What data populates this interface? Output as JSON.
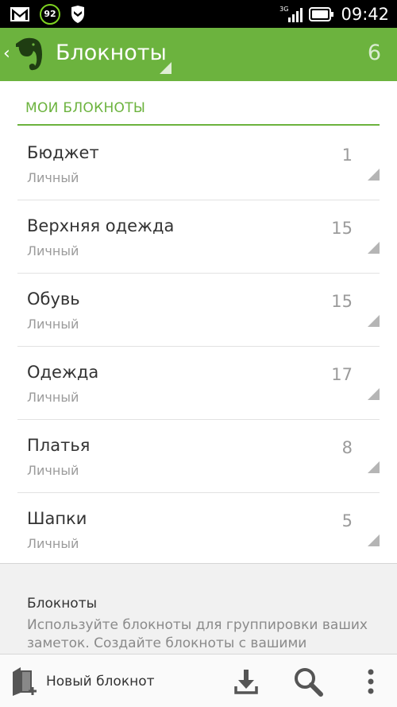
{
  "status_bar": {
    "battery_level": "92",
    "network": "3G",
    "time": "09:42"
  },
  "action_bar": {
    "title": "Блокноты",
    "count": "6"
  },
  "section": {
    "header": "МОИ БЛОКНОТЫ"
  },
  "notebooks": [
    {
      "title": "Бюджет",
      "subtitle": "Личный",
      "count": "1"
    },
    {
      "title": "Верхняя одежда",
      "subtitle": "Личный",
      "count": "15"
    },
    {
      "title": "Обувь",
      "subtitle": "Личный",
      "count": "15"
    },
    {
      "title": "Одежда",
      "subtitle": "Личный",
      "count": "17"
    },
    {
      "title": "Платья",
      "subtitle": "Личный",
      "count": "8"
    },
    {
      "title": "Шапки",
      "subtitle": "Личный",
      "count": "5"
    }
  ],
  "info": {
    "title": "Блокноты",
    "body": "Используйте блокноты для группировки ваших заметок. Создайте блокноты с вашими"
  },
  "bottom_bar": {
    "new_notebook_label": "Новый блокнот"
  },
  "icons": {
    "gmail": "mail-icon",
    "battery_saver": "battery-percent-icon",
    "shield": "shield-icon",
    "signal": "signal-icon",
    "battery": "battery-icon",
    "back": "chevron-left-icon",
    "logo": "evernote-elephant-icon",
    "new_notebook": "new-notebook-icon",
    "sync": "download-icon",
    "search": "search-icon",
    "menu": "overflow-menu-icon"
  },
  "colors": {
    "accent": "#6cb33e",
    "status_bar": "#000000",
    "info_panel": "#f1f1f1"
  }
}
